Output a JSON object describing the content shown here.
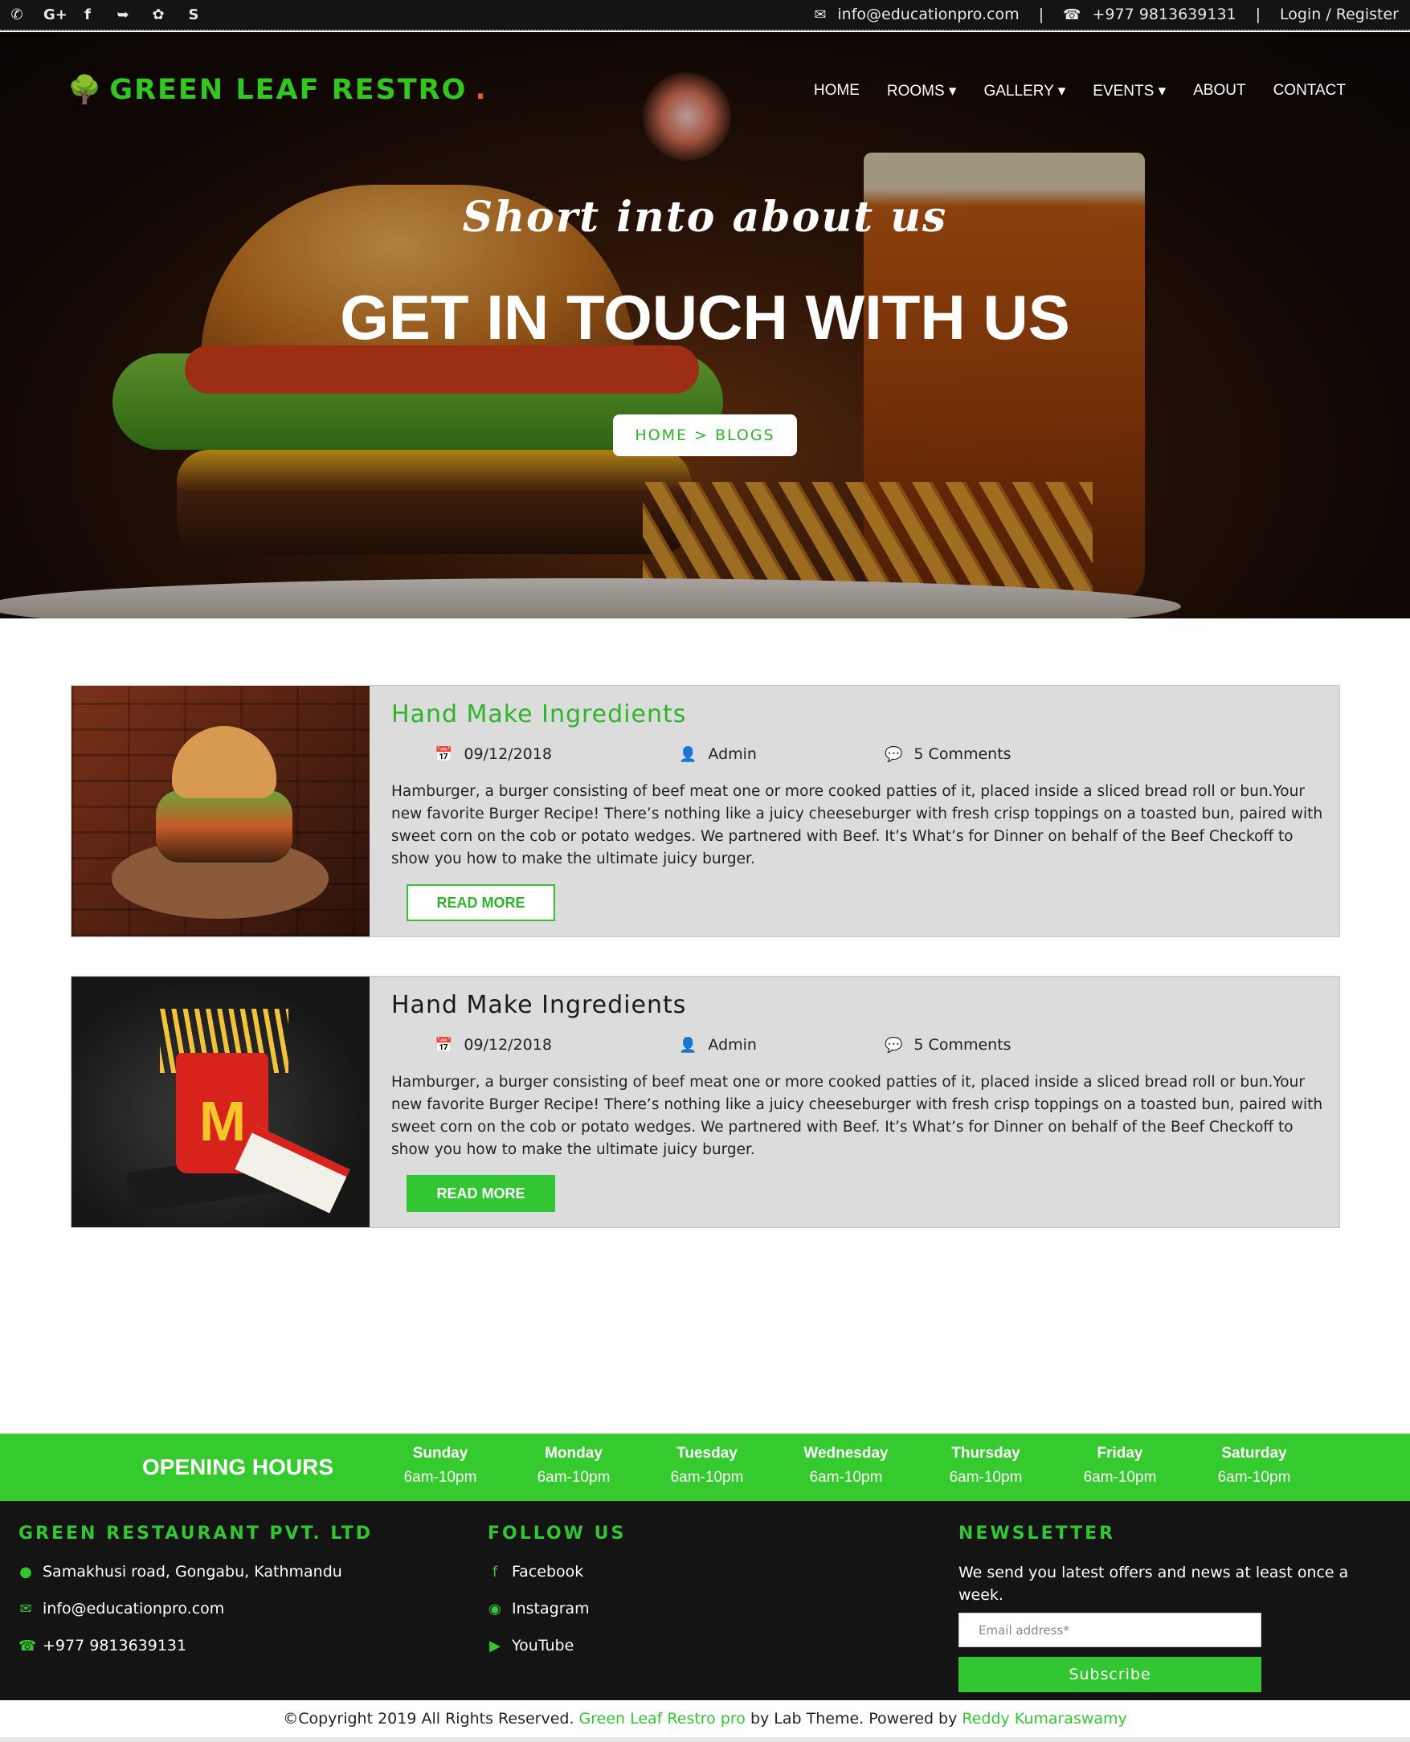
{
  "topbar": {
    "social_icons": [
      "whatsapp-icon",
      "google-plus-icon",
      "facebook-icon",
      "messenger-icon",
      "twitter-icon",
      "skype-icon"
    ],
    "email": "info@educationpro.com",
    "phone": "+977 9813639131",
    "login": "Login / Register",
    "separator": "|"
  },
  "brand": {
    "name": "GREEN LEAF RESTRO",
    "dot": ".",
    "color": "#32c61f",
    "dot_color": "#f05a1a"
  },
  "nav": {
    "items": [
      "HOME",
      "ROOMS ▾",
      "GALLERY ▾",
      "EVENTS ▾",
      "ABOUT",
      "CONTACT"
    ]
  },
  "hero": {
    "subtitle": "Short  into  about  us",
    "title": "GET IN TOUCH WITH US",
    "breadcrumb_home": "HOME",
    "breadcrumb_sep": ">",
    "breadcrumb_current": "BLOGS"
  },
  "posts": [
    {
      "title": "Hand Make Ingredients",
      "title_color": "#2db52a",
      "date": "09/12/2018",
      "author": "Admin",
      "comments": "5 Comments",
      "body": "Hamburger, a burger consisting of beef meat one or more cooked patties of it, placed inside a sliced bread roll or bun.Your new favorite Burger Recipe! There’s nothing like a juicy cheeseburger with fresh crisp toppings on a toasted bun, paired with sweet corn on the cob or potato wedges. We partnered with Beef. It’s What’s for Dinner on behalf of the Beef Checkoff to show you how to make the ultimate juicy burger.",
      "button": "READ MORE"
    },
    {
      "title": "Hand Make Ingredients",
      "title_color": "#1a1a1a",
      "date": "09/12/2018",
      "author": "Admin",
      "comments": "5 Comments",
      "body": "Hamburger, a burger consisting of beef meat one or more cooked patties of it, placed inside a sliced bread roll or bun.Your new favorite Burger Recipe! There’s nothing like a juicy cheeseburger with fresh crisp toppings on a toasted bun, paired with sweet corn on the cob or potato wedges. We partnered with Beef. It’s What’s for Dinner on behalf of the Beef Checkoff to show you how to make the ultimate juicy burger.",
      "button": "READ MORE"
    }
  ],
  "hours": {
    "label": "OPENING HOURS",
    "days": [
      {
        "day": "Sunday",
        "time": "6am-10pm"
      },
      {
        "day": "Monday",
        "time": "6am-10pm"
      },
      {
        "day": "Tuesday",
        "time": "6am-10pm"
      },
      {
        "day": "Wednesday",
        "time": "6am-10pm"
      },
      {
        "day": "Thursday",
        "time": "6am-10pm"
      },
      {
        "day": "Friday",
        "time": "6am-10pm"
      },
      {
        "day": "Saturday",
        "time": "6am-10pm"
      }
    ]
  },
  "footer": {
    "company": {
      "heading": "GREEN RESTAURANT PVT. LTD",
      "address": "Samakhusi road, Gongabu, Kathmandu",
      "email": "info@educationpro.com",
      "phone": "+977 9813639131"
    },
    "follow": {
      "heading": "FOLLOW US",
      "links": [
        "Facebook",
        "Instagram",
        "YouTube"
      ]
    },
    "newsletter": {
      "heading": "NEWSLETTER",
      "text": "We send you latest offers and news at least once a week.",
      "placeholder": "Email address*",
      "button": "Subscribe"
    }
  },
  "copyright": {
    "prefix": "©Copyright 2019 All Rights Reserved.",
    "brand_link": "Green Leaf Restro pro",
    "middle": "by Lab Theme. Powered by",
    "author_link": "Reddy Kumaraswamy"
  }
}
